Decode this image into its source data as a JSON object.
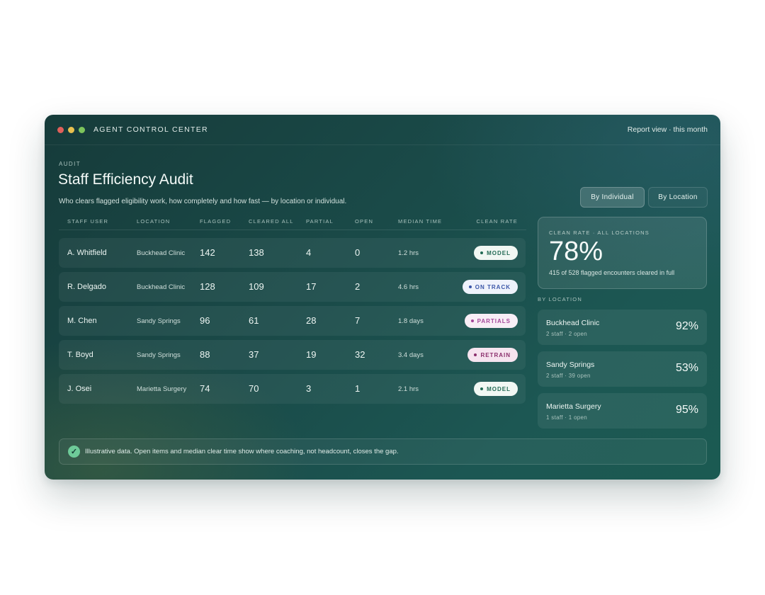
{
  "window": {
    "title": "AGENT CONTROL CENTER",
    "report_view": "Report view · this month"
  },
  "header": {
    "eyebrow": "AUDIT",
    "title": "Staff Efficiency Audit",
    "subtitle": "Who clears flagged eligibility work, how completely and how fast — by location or individual."
  },
  "toggle": {
    "individual_label": "By Individual",
    "location_label": "By Location",
    "active": "By Individual"
  },
  "table": {
    "columns": [
      "STAFF USER",
      "LOCATION",
      "FLAGGED",
      "CLEARED ALL",
      "PARTIAL",
      "OPEN",
      "MEDIAN TIME",
      "CLEAN RATE"
    ],
    "rows": [
      {
        "user": "A. Whitfield",
        "location": "Buckhead Clinic",
        "flagged": "142",
        "cleared_all": "138",
        "partial": "4",
        "open": "0",
        "median_time": "1.2 hrs",
        "clean_rate": "MODEL"
      },
      {
        "user": "R. Delgado",
        "location": "Buckhead Clinic",
        "flagged": "128",
        "cleared_all": "109",
        "partial": "17",
        "open": "2",
        "median_time": "4.6 hrs",
        "clean_rate": "ON TRACK"
      },
      {
        "user": "M. Chen",
        "location": "Sandy Springs",
        "flagged": "96",
        "cleared_all": "61",
        "partial": "28",
        "open": "7",
        "median_time": "1.8 days",
        "clean_rate": "PARTIALS"
      },
      {
        "user": "T. Boyd",
        "location": "Sandy Springs",
        "flagged": "88",
        "cleared_all": "37",
        "partial": "19",
        "open": "32",
        "median_time": "3.4 days",
        "clean_rate": "RETRAIN"
      },
      {
        "user": "J. Osei",
        "location": "Marietta Surgery",
        "flagged": "74",
        "cleared_all": "70",
        "partial": "3",
        "open": "1",
        "median_time": "2.1 hrs",
        "clean_rate": "MODEL"
      }
    ]
  },
  "summary": {
    "label": "CLEAN RATE · ALL LOCATIONS",
    "value": "78%",
    "note": "415 of 528 flagged encounters cleared in full"
  },
  "by_location": {
    "label": "BY LOCATION",
    "items": [
      {
        "name": "Buckhead Clinic",
        "meta": "2 staff · 2 open",
        "pct": "92%"
      },
      {
        "name": "Sandy Springs",
        "meta": "2 staff · 39 open",
        "pct": "53%"
      },
      {
        "name": "Marietta Surgery",
        "meta": "1 staff · 1 open",
        "pct": "95%"
      }
    ]
  },
  "footer": {
    "icon": "check-icon",
    "text": "Illustrative data. Open items and median clear time show where coaching, not headcount, closes the gap."
  },
  "colors": {
    "window_bg": "#1a4b49",
    "badge_model": "#226a54",
    "badge_on_track": "#3a56a8",
    "badge_partials": "#a4479a",
    "badge_retrain": "#8b2f6c",
    "check": "#6ecb99"
  }
}
